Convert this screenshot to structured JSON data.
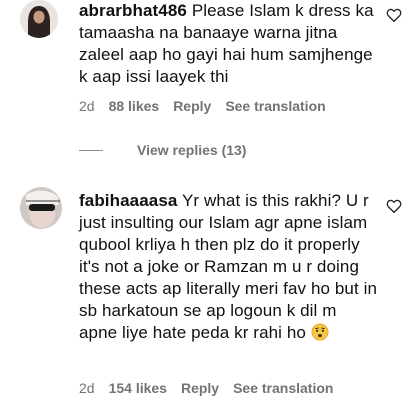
{
  "comments": [
    {
      "username": "abrarbhat486",
      "text": "Please Islam k dress ka tamaasha na banaaye warna jitna zaleel aap ho gayi hai hum samjhenge k aap issi laayek thi",
      "age": "2d",
      "likes": "88 likes",
      "reply_label": "Reply",
      "translation_label": "See translation",
      "view_replies": "View replies (13)"
    },
    {
      "username": "fabihaaaasa",
      "text": "Yr what is this rakhi? U r just insulting our Islam agr apne islam qubool krliya h then plz do it properly it's not a joke or Ramzan m u r doing these acts ap literally meri fav ho but in sb harkatoun se ap logoun k dil m apne liye hate peda kr rahi ho",
      "emoji": "worried-face-emoji",
      "age": "2d",
      "likes": "154 likes",
      "reply_label": "Reply",
      "translation_label": "See translation"
    }
  ],
  "icons": {
    "like": "heart-outline-icon",
    "avatar1": "avatar-hijab",
    "avatar2": "avatar-sunglasses"
  },
  "colors": {
    "text": "#111111",
    "meta": "#737373",
    "background": "#ffffff"
  }
}
